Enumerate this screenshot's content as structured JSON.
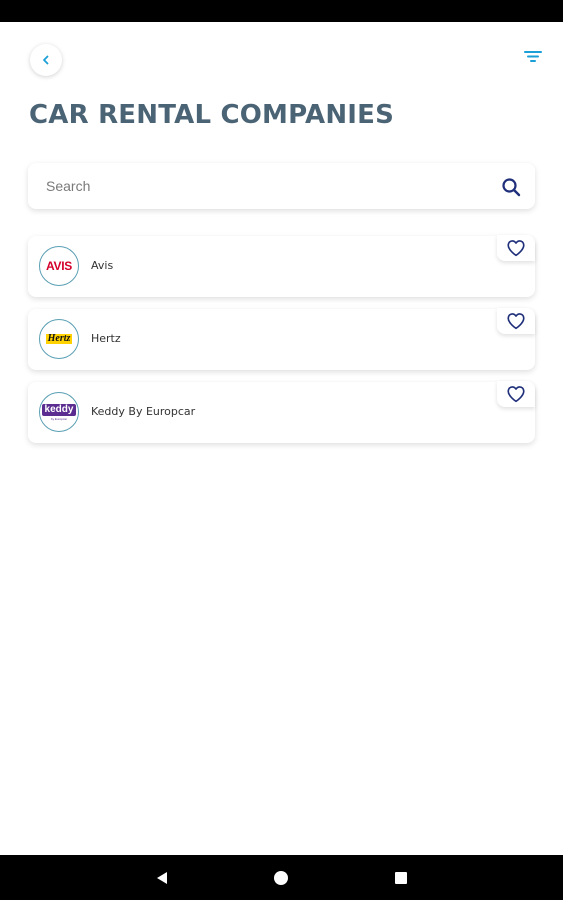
{
  "header": {
    "title": "CAR RENTAL COMPANIES",
    "back_icon": "chevron-left-icon",
    "filter_icon": "filter-icon"
  },
  "search": {
    "placeholder": "Search",
    "value": "",
    "icon": "search-icon"
  },
  "companies": [
    {
      "name": "Avis",
      "logo_text": "AVIS",
      "logo_color": "#d4002a",
      "favorited": false
    },
    {
      "name": "Hertz",
      "logo_text": "Hertz",
      "logo_color": "#ffd200",
      "favorited": false
    },
    {
      "name": "Keddy By Europcar",
      "logo_text": "keddy",
      "logo_sub": "by Europcar",
      "logo_color": "#5b2d90",
      "favorited": false
    }
  ],
  "colors": {
    "title": "#4b6475",
    "accent": "#1a9fd6",
    "heart": "#1f2f7a",
    "logo_border": "#5a9fb4"
  },
  "system_nav": {
    "back_icon": "triangle-back-icon",
    "home_icon": "circle-home-icon",
    "recents_icon": "square-recents-icon"
  }
}
